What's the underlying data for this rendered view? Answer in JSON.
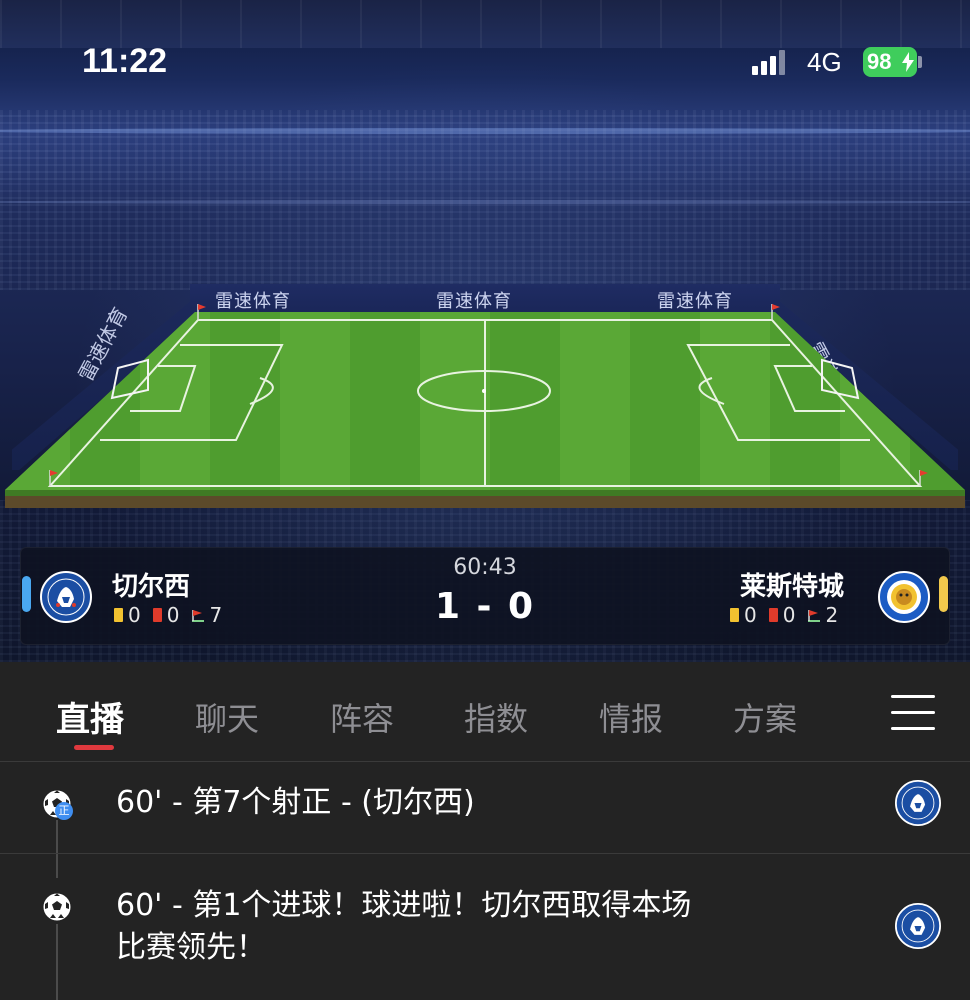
{
  "status_bar": {
    "time": "11:22",
    "network": "4G",
    "battery": "98"
  },
  "stadium": {
    "board_texts": [
      "雷速体育",
      "雷速体育",
      "雷速体育"
    ],
    "side_board_left": "雷速体育",
    "side_board_right": "雷速体育"
  },
  "match": {
    "clock": "60:43",
    "score": "1 - 0",
    "home": {
      "name": "切尔西",
      "yellow": "0",
      "red": "0",
      "corners": "7",
      "accent": "#4aa8f0"
    },
    "away": {
      "name": "莱斯特城",
      "yellow": "0",
      "red": "0",
      "corners": "2",
      "accent": "#f2c94c"
    }
  },
  "tabs": [
    {
      "label": "直播",
      "active": true
    },
    {
      "label": "聊天"
    },
    {
      "label": "阵容"
    },
    {
      "label": "指数"
    },
    {
      "label": "情报"
    },
    {
      "label": "方案"
    }
  ],
  "feed": [
    {
      "text": "60' - 第7个射正 - (切尔西)",
      "icon": "soccer-ball-icon",
      "badge": "正",
      "team": "chelsea"
    },
    {
      "text_line1": "60' - 第1个进球！球进啦！切尔西取得本场",
      "text_line2": "比赛领先！",
      "icon": "soccer-ball-icon",
      "team": "chelsea"
    }
  ],
  "colors": {
    "accent_red": "#e0393e",
    "background": "#232323",
    "battery_green": "#3fcd5c"
  }
}
